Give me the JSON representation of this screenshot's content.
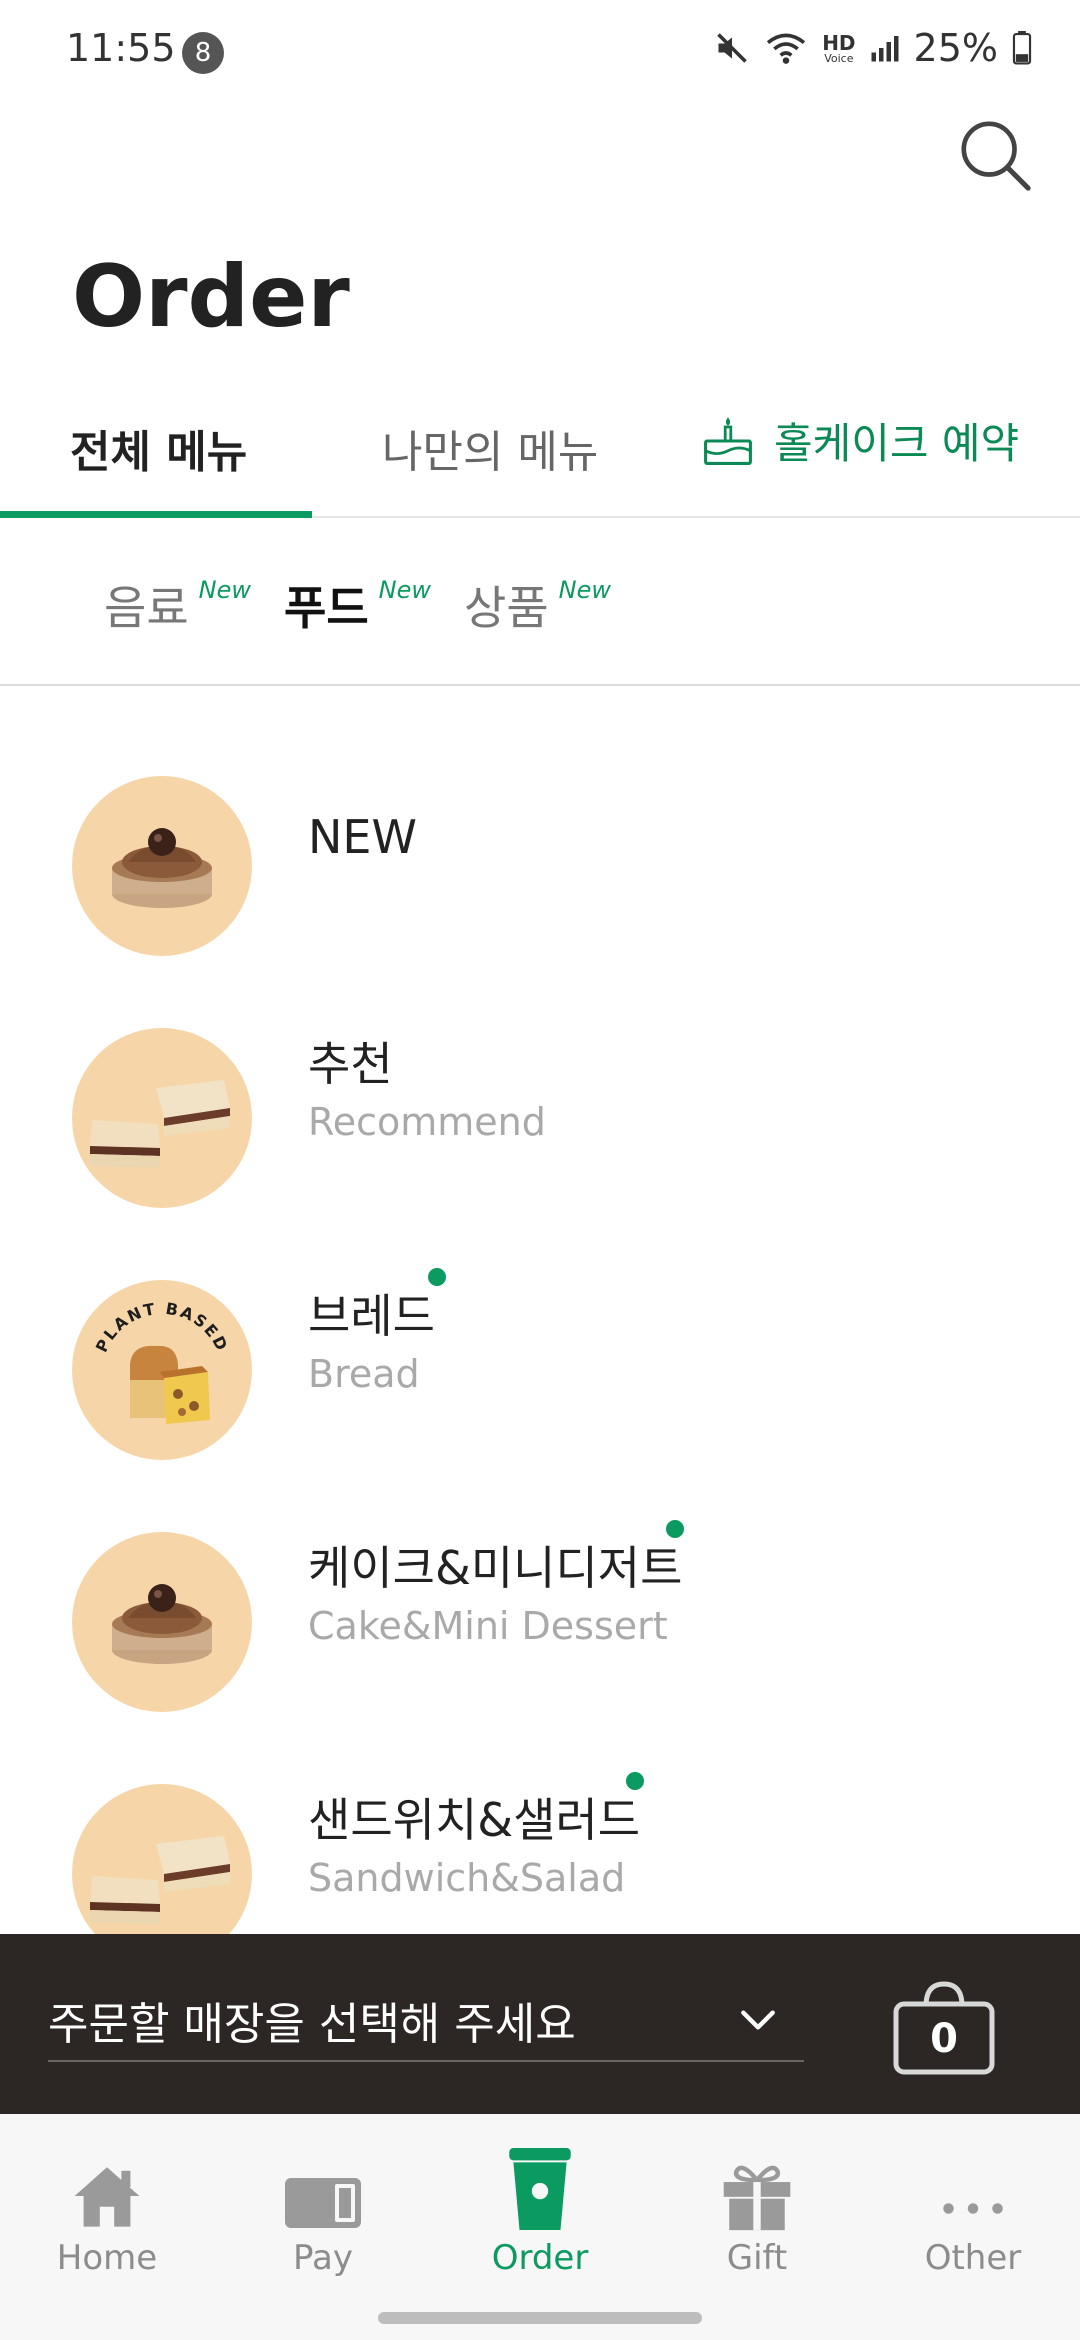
{
  "status_bar": {
    "time": "11:55",
    "notification_count": "8",
    "hd_label": "HD",
    "voice_label": "Voice",
    "battery": "25%"
  },
  "header": {
    "title": "Order"
  },
  "tabs": [
    {
      "label": "전체 메뉴",
      "active": true
    },
    {
      "label": "나만의 메뉴",
      "active": false
    },
    {
      "label": "홀케이크 예약",
      "icon": "cake-icon"
    }
  ],
  "subcategories": [
    {
      "label": "음료",
      "badge": "New",
      "active": false
    },
    {
      "label": "푸드",
      "badge": "New",
      "active": true
    },
    {
      "label": "상품",
      "badge": "New",
      "active": false
    }
  ],
  "menu_items": [
    {
      "title": "NEW",
      "subtitle": "",
      "image": "chestnut-tart",
      "has_dot": false
    },
    {
      "title": "추천",
      "subtitle": "Recommend",
      "image": "sandwich",
      "has_dot": false
    },
    {
      "title": "브레드",
      "subtitle": "Bread",
      "image": "bread-plant-based",
      "badge_text": "PLANT BASED",
      "has_dot": true
    },
    {
      "title": "케이크&미니디저트",
      "subtitle": "Cake&Mini Dessert",
      "image": "chestnut-tart",
      "has_dot": true
    },
    {
      "title": "샌드위치&샐러드",
      "subtitle": "Sandwich&Salad",
      "image": "sandwich",
      "has_dot": true
    }
  ],
  "store_selector": {
    "label": "주문할 매장을 선택해 주세요",
    "cart_count": "0"
  },
  "bottom_nav": [
    {
      "label": "Home",
      "icon": "home-icon",
      "active": false
    },
    {
      "label": "Pay",
      "icon": "card-icon",
      "active": false
    },
    {
      "label": "Order",
      "icon": "cup-icon",
      "active": true
    },
    {
      "label": "Gift",
      "icon": "gift-icon",
      "active": false
    },
    {
      "label": "Other",
      "icon": "more-icon",
      "active": false
    }
  ],
  "colors": {
    "accent": "#0b9a5f",
    "store_bar": "#2c2725",
    "thumb_bg": "#f6d6a8"
  }
}
